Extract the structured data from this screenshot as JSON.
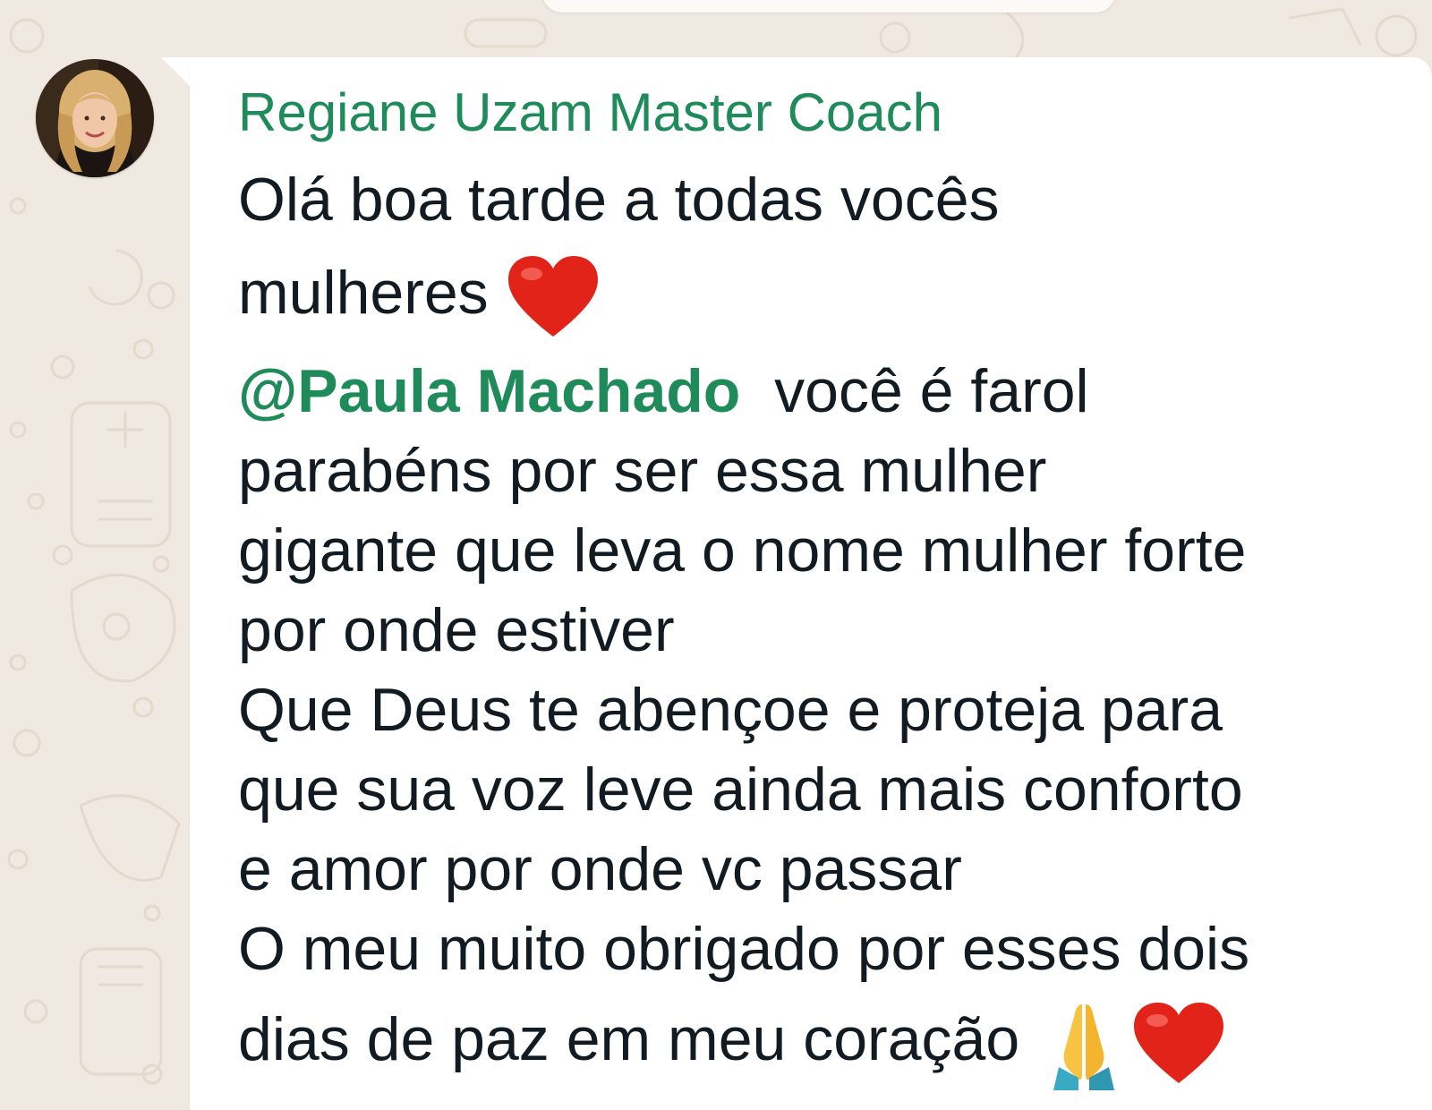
{
  "chat": {
    "sender_name": "Regiane Uzam Master Coach",
    "avatar_icon": "profile-photo-avatar",
    "accent_color": "#1f8a5a",
    "message": {
      "line1": "Olá boa tarde a todas vocês",
      "line2": "mulheres",
      "line2_emoji": "red-heart-icon",
      "mention": "@Paula Machado",
      "line3_rest": "você é farol",
      "line4": "parabéns por ser essa mulher",
      "line5": "gigante que leva o nome mulher forte",
      "line6": "por onde estiver",
      "line7": "Que Deus te abençoe e proteja para",
      "line8": "que sua voz leve ainda mais conforto",
      "line9": "e amor por onde vc passar",
      "line10": "O meu muito obrigado por esses dois",
      "line11": "dias de paz em meu coração",
      "line11_emojis": [
        "folded-hands-icon",
        "red-heart-icon"
      ]
    }
  }
}
